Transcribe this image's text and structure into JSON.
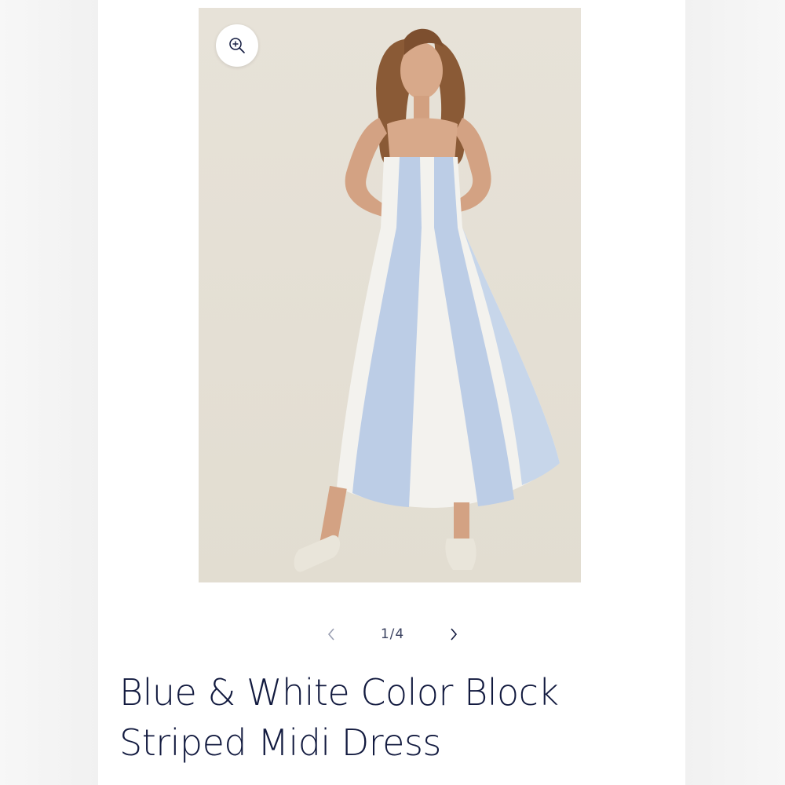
{
  "gallery": {
    "image_alt": "Model wearing blue and white color block striped midi dress",
    "zoom_icon": "zoom-in-icon",
    "prev_icon": "chevron-left-icon",
    "next_icon": "chevron-right-icon",
    "counter": "1/4"
  },
  "product": {
    "title_line1": "Blue & White Color Block",
    "title_line2": "Striped Midi Dress"
  },
  "colors": {
    "text": "#121a3f",
    "photo_bg": "#e5e0d5",
    "dress_blue": "#bccde6",
    "dress_white": "#f3f2ee"
  }
}
